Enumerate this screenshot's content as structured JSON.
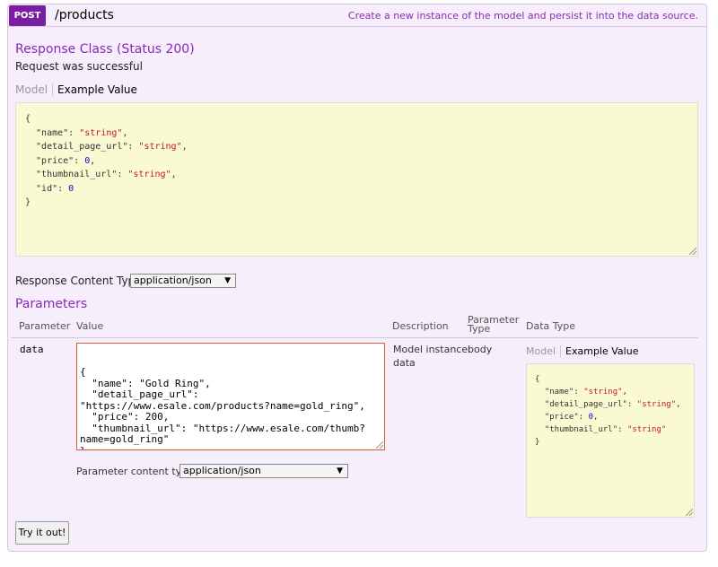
{
  "operation": {
    "method": "POST",
    "path": "/products",
    "summary": "Create a new instance of the model and persist it into the data source."
  },
  "response": {
    "heading": "Response Class (Status 200)",
    "status_text": "Request was successful",
    "tab_model": "Model",
    "tab_example": "Example Value",
    "example_lines": [
      {
        "indent": "",
        "key": "",
        "value": "{",
        "type": "punct",
        "comma": ""
      },
      {
        "indent": "  ",
        "key": "\"name\": ",
        "value": "\"string\"",
        "type": "str",
        "comma": ","
      },
      {
        "indent": "  ",
        "key": "\"detail_page_url\": ",
        "value": "\"string\"",
        "type": "str",
        "comma": ","
      },
      {
        "indent": "  ",
        "key": "\"price\": ",
        "value": "0",
        "type": "num",
        "comma": ","
      },
      {
        "indent": "  ",
        "key": "\"thumbnail_url\": ",
        "value": "\"string\"",
        "type": "str",
        "comma": ","
      },
      {
        "indent": "  ",
        "key": "\"id\": ",
        "value": "0",
        "type": "num",
        "comma": ""
      },
      {
        "indent": "",
        "key": "",
        "value": "}",
        "type": "punct",
        "comma": ""
      }
    ],
    "content_type_label": "Response Content Type",
    "content_type_value": "application/json"
  },
  "parameters": {
    "heading": "Parameters",
    "columns": {
      "parameter": "Parameter",
      "value": "Value",
      "description": "Description",
      "parameter_type_line1": "Parameter",
      "parameter_type_line2": "Type",
      "data_type": "Data Type"
    },
    "row": {
      "name": "data",
      "body_lines": [
        "{",
        "  \"name\": \"Gold Ring\",",
        "  \"detail_page_url\":",
        "\"https://www.esale.com/products?name=gold_ring\",",
        "  \"price\": 200,",
        "  \"thumbnail_url\": \"https://www.esale.com/thumb?",
        "name=gold_ring\"",
        "}"
      ],
      "description_line1": "Model instance",
      "description_line2": "data",
      "param_type": "body",
      "tab_model": "Model",
      "tab_example": "Example Value",
      "schema_lines": [
        {
          "indent": "",
          "key": "",
          "value": "{",
          "type": "punct",
          "comma": ""
        },
        {
          "indent": "  ",
          "key": "\"name\": ",
          "value": "\"string\"",
          "type": "str",
          "comma": ","
        },
        {
          "indent": "  ",
          "key": "\"detail_page_url\": ",
          "value": "\"string\"",
          "type": "str",
          "comma": ","
        },
        {
          "indent": "  ",
          "key": "\"price\": ",
          "value": "0",
          "type": "num",
          "comma": ","
        },
        {
          "indent": "  ",
          "key": "\"thumbnail_url\": ",
          "value": "\"string\"",
          "type": "str",
          "comma": ""
        },
        {
          "indent": "",
          "key": "",
          "value": "}",
          "type": "punct",
          "comma": ""
        }
      ],
      "content_type_label": "Parameter content type:",
      "content_type_value": "application/json"
    }
  },
  "try_button": "Try it out!"
}
